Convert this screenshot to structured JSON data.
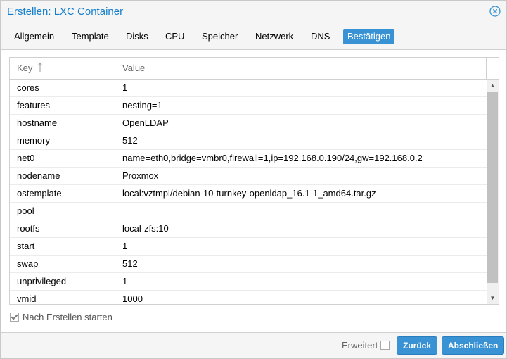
{
  "dialog": {
    "title": "Erstellen: LXC Container",
    "close_icon": "close-icon"
  },
  "tabs": [
    {
      "label": "Allgemein"
    },
    {
      "label": "Template"
    },
    {
      "label": "Disks"
    },
    {
      "label": "CPU"
    },
    {
      "label": "Speicher"
    },
    {
      "label": "Netzwerk"
    },
    {
      "label": "DNS"
    },
    {
      "label": "Bestätigen",
      "active": true
    }
  ],
  "grid": {
    "columns": {
      "key": "Key",
      "value": "Value"
    },
    "sort": "ascending",
    "rows": [
      {
        "key": "cores",
        "value": "1"
      },
      {
        "key": "features",
        "value": "nesting=1"
      },
      {
        "key": "hostname",
        "value": "OpenLDAP"
      },
      {
        "key": "memory",
        "value": "512"
      },
      {
        "key": "net0",
        "value": "name=eth0,bridge=vmbr0,firewall=1,ip=192.168.0.190/24,gw=192.168.0.2"
      },
      {
        "key": "nodename",
        "value": "Proxmox"
      },
      {
        "key": "ostemplate",
        "value": "local:vztmpl/debian-10-turnkey-openldap_16.1-1_amd64.tar.gz"
      },
      {
        "key": "pool",
        "value": ""
      },
      {
        "key": "rootfs",
        "value": "local-zfs:10"
      },
      {
        "key": "start",
        "value": "1"
      },
      {
        "key": "swap",
        "value": "512"
      },
      {
        "key": "unprivileged",
        "value": "1"
      },
      {
        "key": "vmid",
        "value": "1000"
      }
    ]
  },
  "options": {
    "start_after_create": {
      "label": "Nach Erstellen starten",
      "checked": true
    }
  },
  "footer": {
    "advanced_label": "Erweitert",
    "advanced_checked": false,
    "back_label": "Zurück",
    "finish_label": "Abschließen"
  },
  "colors": {
    "accent": "#3892d4",
    "title": "#157fcc"
  }
}
